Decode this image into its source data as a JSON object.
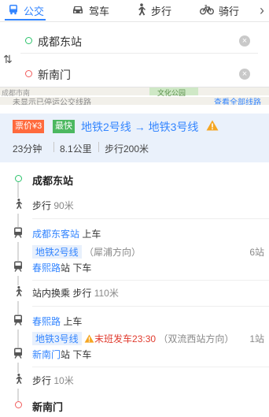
{
  "tabs": [
    {
      "label": "公交",
      "icon": "bus-icon",
      "active": true
    },
    {
      "label": "驾车",
      "icon": "car-icon",
      "active": false
    },
    {
      "label": "步行",
      "icon": "walk-icon",
      "active": false
    },
    {
      "label": "骑行",
      "icon": "bicycle-icon",
      "active": false
    }
  ],
  "more_tabs_glyph": "›",
  "start_value": "成都东站",
  "end_value": "新南门",
  "map_strip": {
    "left_label": "成都市南",
    "mid_label": "",
    "park_label": "文化公园",
    "note": "未显示已停运公交线路",
    "link": "查看全部线路"
  },
  "summary": {
    "price_badge": "票价¥3",
    "fast_badge": "最快",
    "line_a": "地铁2号线",
    "arrow": "→",
    "line_b": "地铁3号线",
    "duration": "23分钟",
    "distance": "8.1公里",
    "walk": "步行200米"
  },
  "steps": {
    "start_name": "成都东站",
    "walk1_label": "步行",
    "walk1_dist": "90米",
    "board1_station": "成都东客站",
    "board1_suffix": "上车",
    "line1_name": "地铁2号线",
    "line1_dir": "（犀浦方向）",
    "line1_stops": "6站",
    "alight1_station": "春熙路",
    "alight1_suffix": "站 下车",
    "transfer_label": "站内换乘 步行",
    "transfer_dist": "110米",
    "board2_station": "春熙路",
    "board2_suffix": "上车",
    "line2_name": "地铁3号线",
    "line2_warn": "末班发车23:30",
    "line2_dir": "（双流西站方向）",
    "line2_stops": "1站",
    "alight2_station": "新南门",
    "alight2_suffix": "站 下车",
    "walk2_label": "步行",
    "walk2_dist": "10米",
    "end_name": "新南门"
  },
  "colors": {
    "accent": "#3385ff",
    "start_green": "#2cc36b",
    "end_red": "#f25c5c",
    "price": "#ff6a3d",
    "fast": "#4cb860"
  }
}
